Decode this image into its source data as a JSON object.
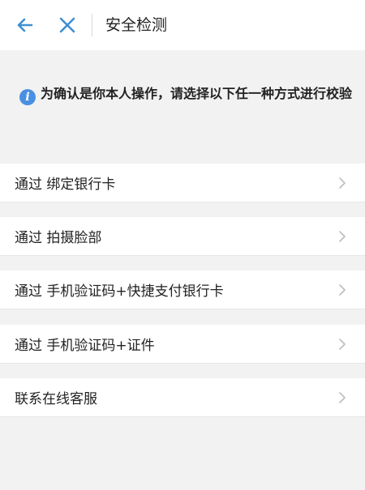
{
  "header": {
    "title": "安全检测",
    "back_icon": "arrow-left-icon",
    "close_icon": "close-icon",
    "accent_color": "#3f8fd2"
  },
  "notice": {
    "icon": "info-icon",
    "icon_glyph": "i",
    "text": "为确认是你本人操作，请选择以下任一种方式进行校验"
  },
  "options": [
    {
      "label": "通过 绑定银行卡"
    },
    {
      "label": "通过 拍摄脸部"
    },
    {
      "label": "通过 手机验证码+快捷支付银行卡"
    },
    {
      "label": "通过 手机验证码+证件"
    },
    {
      "label": "联系在线客服"
    }
  ]
}
